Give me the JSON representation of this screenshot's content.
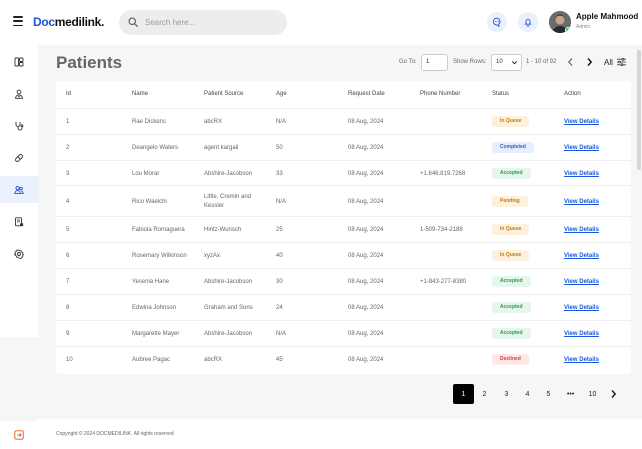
{
  "header": {
    "logo_part1": "Doc",
    "logo_part2": "medilink.",
    "search_placeholder": "Search here...",
    "user_name": "Apple Mahmood",
    "user_role": "Admin"
  },
  "sidebar": {
    "items": [
      {
        "icon": "layout-icon"
      },
      {
        "icon": "doctor-icon"
      },
      {
        "icon": "stethoscope-icon"
      },
      {
        "icon": "pill-icon"
      },
      {
        "icon": "patients-icon",
        "active": true
      },
      {
        "icon": "report-icon"
      },
      {
        "icon": "settings-icon"
      }
    ],
    "bottom_icon": "logout-icon"
  },
  "page": {
    "title": "Patients",
    "goto_label": "Go To:",
    "goto_value": "1",
    "show_rows_label": "Show Rows:",
    "rows_value": "10",
    "range_text": "1 - 10 of 92",
    "all_label": "All"
  },
  "table": {
    "columns": [
      "Id",
      "Name",
      "Patient Source",
      "Age",
      "Request Date",
      "Phone Number",
      "Status",
      "Action"
    ],
    "rows": [
      {
        "id": "1",
        "name": "Rae Dickens",
        "source": "abcRX",
        "age": "N/A",
        "date": "08 Aug, 2024",
        "phone": "",
        "status": "In Queue",
        "action": "View Details"
      },
      {
        "id": "2",
        "name": "Deangelo Waters",
        "source": "agent kargail",
        "age": "50",
        "date": "08 Aug, 2024",
        "phone": "",
        "status": "Completed",
        "action": "View Details"
      },
      {
        "id": "3",
        "name": "Lou Morar",
        "source": "Abshire-Jacobson",
        "age": "33",
        "date": "08 Aug, 2024",
        "phone": "+1.646.819.7268",
        "status": "Accepted",
        "action": "View Details"
      },
      {
        "id": "4",
        "name": "Rico Waelchi",
        "source": "Little, Cremin and Kessler",
        "age": "N/A",
        "date": "08 Aug, 2024",
        "phone": "",
        "status": "Pending",
        "action": "View Details"
      },
      {
        "id": "5",
        "name": "Fabiola Romaguera",
        "source": "Hintz-Wunsch",
        "age": "25",
        "date": "08 Aug, 2024",
        "phone": "1-509-734-2188",
        "status": "In Queue",
        "action": "View Details"
      },
      {
        "id": "6",
        "name": "Rosemary Wilkinson",
        "source": "xyzAx",
        "age": "40",
        "date": "08 Aug, 2024",
        "phone": "",
        "status": "In Queue",
        "action": "View Details"
      },
      {
        "id": "7",
        "name": "Yesenia Hane",
        "source": "Abshire-Jacobson",
        "age": "30",
        "date": "08 Aug, 2024",
        "phone": "+1-843-277-8380",
        "status": "Accepted",
        "action": "View Details"
      },
      {
        "id": "8",
        "name": "Edwina Johnson",
        "source": "Graham and Sons",
        "age": "24",
        "date": "08 Aug, 2024",
        "phone": "",
        "status": "Accepted",
        "action": "View Details"
      },
      {
        "id": "9",
        "name": "Margarette Mayer",
        "source": "Abshire-Jacobson",
        "age": "N/A",
        "date": "08 Aug, 2024",
        "phone": "",
        "status": "Accepted",
        "action": "View Details"
      },
      {
        "id": "10",
        "name": "Aubree Pagac",
        "source": "abcRX",
        "age": "45",
        "date": "08 Aug, 2024",
        "phone": "",
        "status": "Declined",
        "action": "View Details"
      }
    ]
  },
  "status_colors": {
    "In Queue": {
      "bg": "#fdf1de",
      "fg": "#c07b14"
    },
    "Completed": {
      "bg": "#e6eefc",
      "fg": "#2f62c9"
    },
    "Accepted": {
      "bg": "#e5f6ea",
      "fg": "#2d9a4f"
    },
    "Pending": {
      "bg": "#fdf1de",
      "fg": "#c07b14"
    },
    "Declined": {
      "bg": "#fde7e7",
      "fg": "#d24040"
    }
  },
  "pagination": {
    "pages": [
      "1",
      "2",
      "3",
      "4",
      "5",
      "•••",
      "10"
    ],
    "active": "1"
  },
  "footer": {
    "copyright": "Copyright © 2024 DOCMEDILINK. All rights reserved"
  },
  "colors": {
    "accent": "#1a56db",
    "active_sidebar_bg": "#eaf1fd"
  }
}
